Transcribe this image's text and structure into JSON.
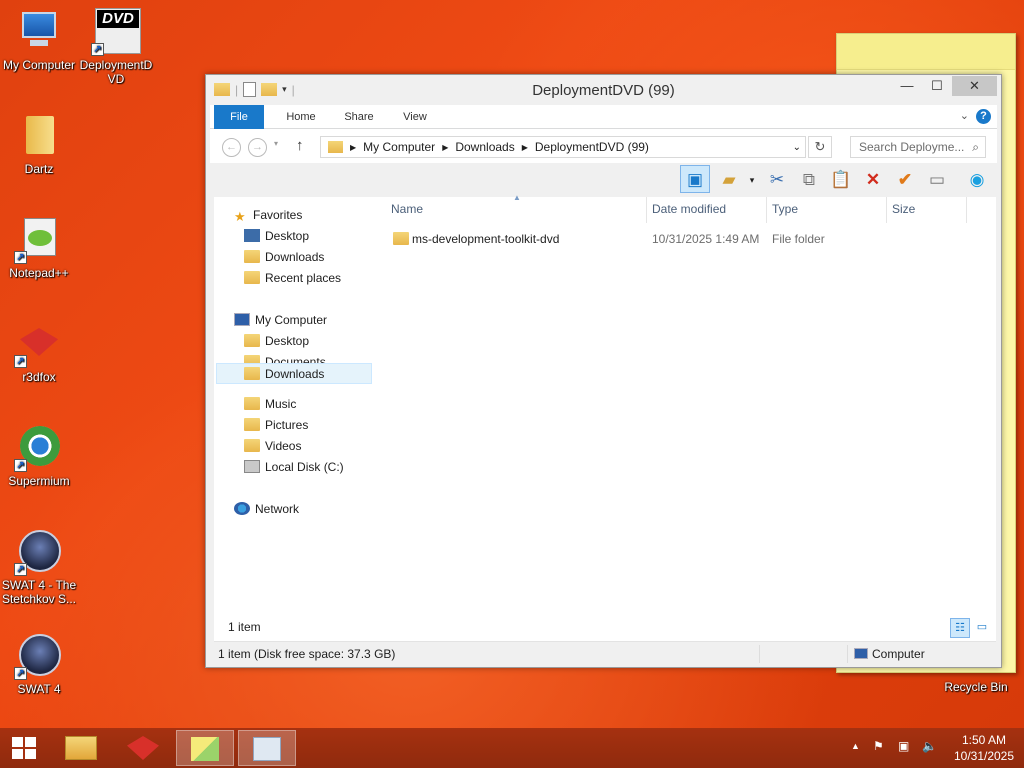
{
  "desktop": {
    "icons": [
      {
        "label": "My Computer"
      },
      {
        "label": "DeploymentD VD"
      },
      {
        "label": "Dartz"
      },
      {
        "label": "Notepad++"
      },
      {
        "label": "r3dfox"
      },
      {
        "label": "Supermium"
      },
      {
        "label": "SWAT 4 - The Stetchkov S..."
      },
      {
        "label": "SWAT 4"
      },
      {
        "label": "Recycle Bin"
      }
    ],
    "dvd_icon_text": "DVD"
  },
  "window": {
    "title": "DeploymentDVD (99)",
    "tabs": [
      "File",
      "Home",
      "Share",
      "View"
    ],
    "breadcrumb": [
      "My Computer",
      "Downloads",
      "DeploymentDVD (99)"
    ],
    "search_placeholder": "Search Deployme...",
    "columns": [
      "Name",
      "Date modified",
      "Type",
      "Size"
    ],
    "files": [
      {
        "name": "ms-development-toolkit-dvd",
        "date": "10/31/2025 1:49 AM",
        "type": "File folder",
        "size": ""
      }
    ],
    "nav": {
      "favorites": {
        "label": "Favorites",
        "items": [
          "Desktop",
          "Downloads",
          "Recent places"
        ]
      },
      "computer": {
        "label": "My Computer",
        "items": [
          "Desktop",
          "Documents",
          "Downloads",
          "Music",
          "Pictures",
          "Videos",
          "Local Disk (C:)"
        ],
        "selected": "Downloads"
      },
      "network": {
        "label": "Network"
      }
    },
    "item_count": "1 item",
    "status": "1 item (Disk free space: 37.3 GB)",
    "status_right": "Computer"
  },
  "taskbar": {
    "time": "1:50 AM",
    "date": "10/31/2025"
  },
  "colors": {
    "accent": "#1979ca",
    "taskbar": "#9a2e0e"
  }
}
